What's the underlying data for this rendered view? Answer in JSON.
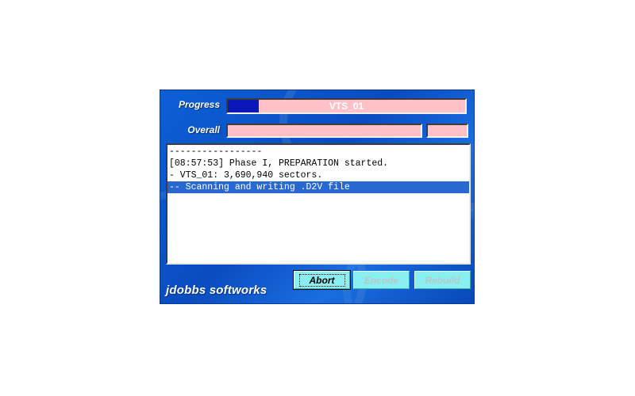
{
  "labels": {
    "progress": "Progress",
    "overall": "Overall"
  },
  "progress_bar": {
    "text": "VTS_01",
    "fraction": 0.13,
    "fill_color": "#0a18b8",
    "track_color": "#ffc0c8"
  },
  "overall_bar": {
    "fraction": 0
  },
  "log": {
    "lines": [
      {
        "text": "-----------------",
        "selected": false
      },
      {
        "text": "[08:57:53] Phase I, PREPARATION started.",
        "selected": false
      },
      {
        "text": "- VTS_01: 3,690,940 sectors.",
        "selected": false
      },
      {
        "text": "-- Scanning and writing .D2V file",
        "selected": true
      }
    ]
  },
  "buttons": {
    "abort": "Abort",
    "encode": "Encode",
    "rebuild": "Rebuild"
  },
  "brand": "jdobbs softworks",
  "colors": {
    "window": "#0d5fd6",
    "button": "#88f0f0",
    "selection": "#2868d0"
  }
}
